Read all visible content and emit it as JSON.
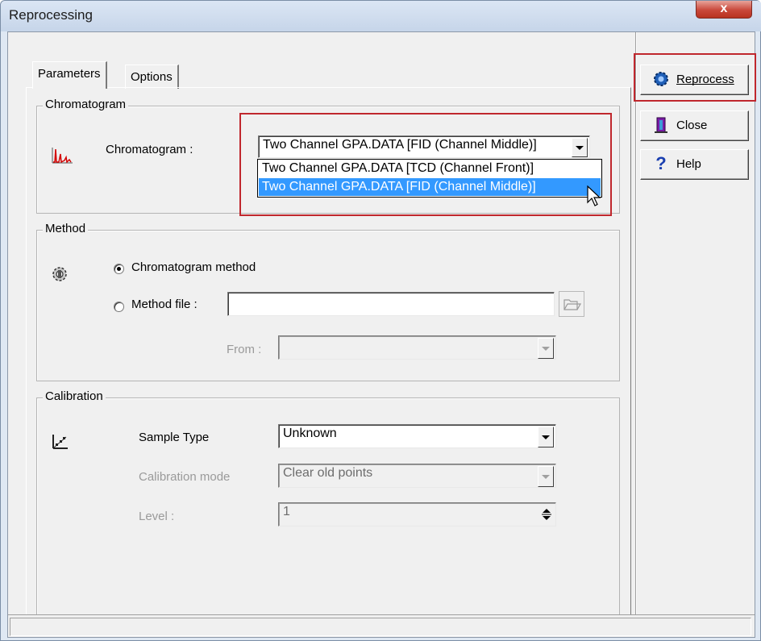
{
  "window": {
    "title": "Reprocessing",
    "close_glyph": "x"
  },
  "tabs": [
    {
      "label": "Parameters",
      "active": true
    },
    {
      "label": "Options",
      "active": false
    }
  ],
  "chromatogram_group": {
    "title": "Chromatogram",
    "label": "Chromatogram :",
    "selected": "Two Channel GPA.DATA [FID  (Channel Middle)]",
    "options": [
      "Two Channel GPA.DATA [TCD  (Channel Front)]",
      "Two Channel GPA.DATA [FID  (Channel Middle)]"
    ],
    "icon": "chromatogram-icon"
  },
  "method_group": {
    "title": "Method",
    "radio_chromatogram": "Chromatogram method",
    "radio_file": "Method file :",
    "method_file_value": "",
    "from_label": "From :",
    "from_value": "",
    "icon": "method-gear-icon"
  },
  "calibration_group": {
    "title": "Calibration",
    "sample_type_label": "Sample Type",
    "sample_type_value": "Unknown",
    "calibration_mode_label": "Calibration mode",
    "calibration_mode_value": "Clear old points",
    "level_label": "Level :",
    "level_value": "1",
    "icon": "calibration-icon"
  },
  "buttons": {
    "reprocess": "Reprocess",
    "close": "Close",
    "help": "Help"
  },
  "colors": {
    "highlight_box": "#c0272d",
    "selection": "#3399ff",
    "chromatogram_trace": "#d40000"
  }
}
